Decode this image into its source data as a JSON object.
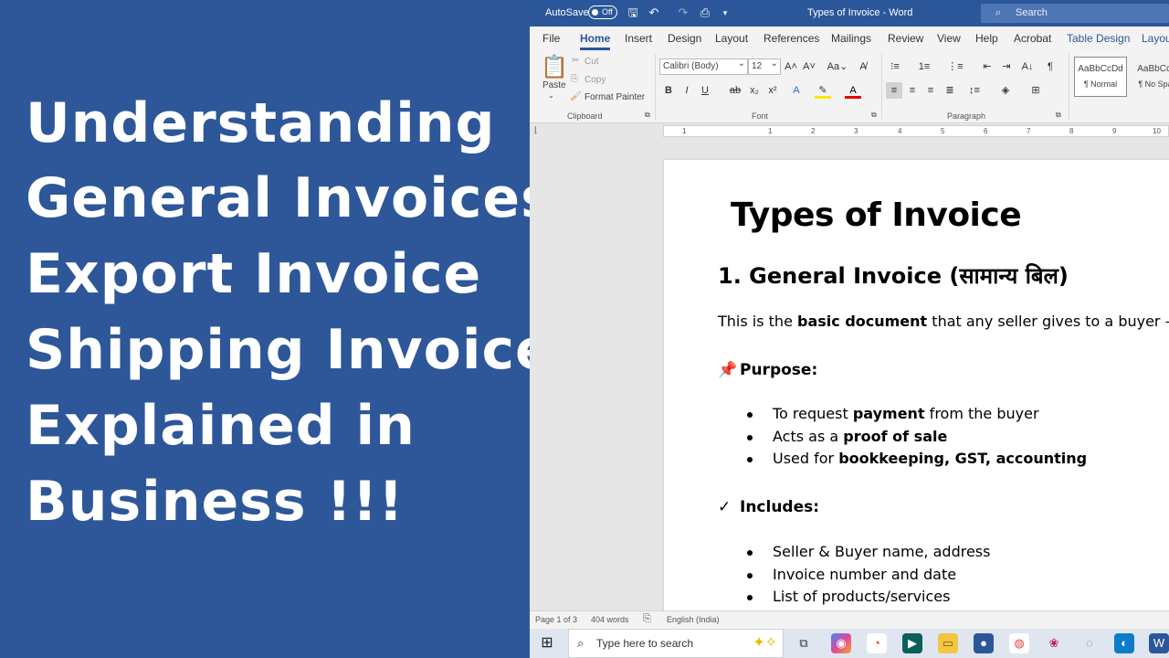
{
  "promo": {
    "lines": [
      "Understanding",
      "General Invoices",
      "Export Invoice",
      "Shipping Invoice",
      "Explained in",
      "Business !!!"
    ]
  },
  "titlebar": {
    "autosave_label": "AutoSave",
    "autosave_state": "Off",
    "window_title": "Types of Invoice  -  Word",
    "search_placeholder": "Search"
  },
  "tabs": [
    "File",
    "Home",
    "Insert",
    "Design",
    "Layout",
    "References",
    "Mailings",
    "Review",
    "View",
    "Help",
    "Acrobat",
    "Table Design",
    "Layout"
  ],
  "ribbon": {
    "clipboard": {
      "paste": "Paste",
      "cut": "Cut",
      "copy": "Copy",
      "format_painter": "Format Painter",
      "group_label": "Clipboard"
    },
    "font": {
      "family": "Calibri (Body)",
      "size": "12",
      "group_label": "Font",
      "bold": "B",
      "italic": "I",
      "underline": "U"
    },
    "paragraph": {
      "group_label": "Paragraph"
    },
    "styles": [
      {
        "preview": "AaBbCcDd",
        "name": "¶ Normal"
      },
      {
        "preview": "AaBbCcI",
        "name": "¶ No Spa"
      }
    ]
  },
  "ruler": {
    "numbers": [
      "1",
      "1",
      "2",
      "3",
      "4",
      "5",
      "6",
      "7",
      "8",
      "9",
      "10"
    ]
  },
  "document": {
    "title": "Types of Invoice",
    "heading1": "1. General Invoice (सामान्य बिल)",
    "intro": {
      "before": "This is the ",
      "bold": "basic document",
      "after": " that any seller gives to a buyer —"
    },
    "purpose": {
      "icon": "📌",
      "label": "Purpose:",
      "items": [
        {
          "before": "To request ",
          "bold": "payment",
          "after": " from the buyer"
        },
        {
          "before": "Acts as a ",
          "bold": "proof of sale",
          "after": ""
        },
        {
          "before": "Used for ",
          "bold": "bookkeeping, GST, accounting",
          "after": ""
        }
      ]
    },
    "includes": {
      "icon": "✓",
      "label": "Includes:",
      "items": [
        {
          "before": "Seller & Buyer name, address",
          "bold": "",
          "after": ""
        },
        {
          "before": "Invoice number and date",
          "bold": "",
          "after": ""
        },
        {
          "before": "List of products/services",
          "bold": "",
          "after": ""
        }
      ]
    }
  },
  "status": {
    "page": "Page 1 of 3",
    "words": "404 words",
    "language": "English (India)"
  },
  "taskbar": {
    "search_placeholder": "Type here to search"
  },
  "colors": {
    "brand": "#2b579a",
    "promo_bg": "#2d5799"
  }
}
